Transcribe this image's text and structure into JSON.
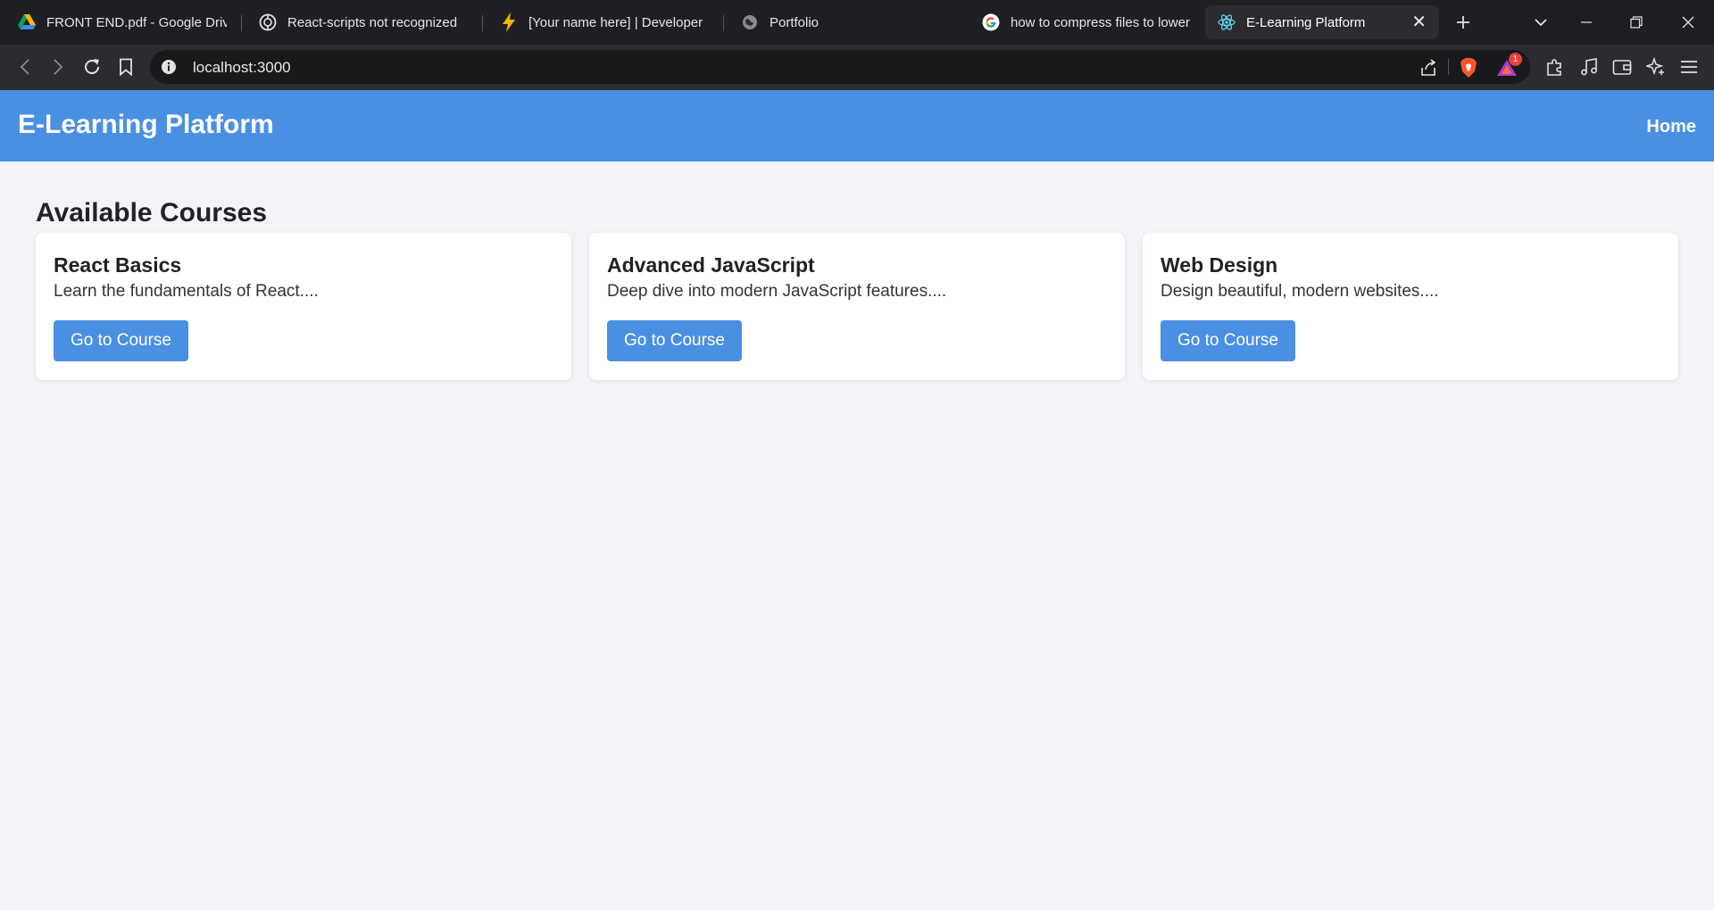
{
  "browser": {
    "tabs": [
      {
        "title": "FRONT END.pdf - Google Drive",
        "icon": "google-drive-icon",
        "active": false
      },
      {
        "title": "React-scripts not recognized",
        "icon": "chatgpt-icon",
        "active": false
      },
      {
        "title": "[Your name here] | Developer",
        "icon": "lightning-icon",
        "active": false
      },
      {
        "title": "Portfolio",
        "icon": "globe-icon",
        "active": false
      },
      {
        "title": "how to compress files to lower",
        "icon": "google-icon",
        "active": false
      },
      {
        "title": "E-Learning Platform",
        "icon": "react-icon",
        "active": true
      }
    ],
    "address": {
      "url": "localhost:3000"
    },
    "notification_count": "1",
    "colors": {
      "tabstrip": "#1f1f23",
      "toolbar": "#2b2b30",
      "omnibox": "#19191c"
    }
  },
  "app": {
    "header": {
      "title": "E-Learning Platform",
      "nav": {
        "home": "Home"
      }
    },
    "section_title": "Available Courses",
    "courses": [
      {
        "title": "React Basics",
        "description": "Learn the fundamentals of React....",
        "button": "Go to Course"
      },
      {
        "title": "Advanced JavaScript",
        "description": "Deep dive into modern JavaScript features....",
        "button": "Go to Course"
      },
      {
        "title": "Web Design",
        "description": "Design beautiful, modern websites....",
        "button": "Go to Course"
      }
    ],
    "colors": {
      "primary": "#4a90e2",
      "background": "#f3f3f8",
      "card": "#ffffff"
    }
  }
}
